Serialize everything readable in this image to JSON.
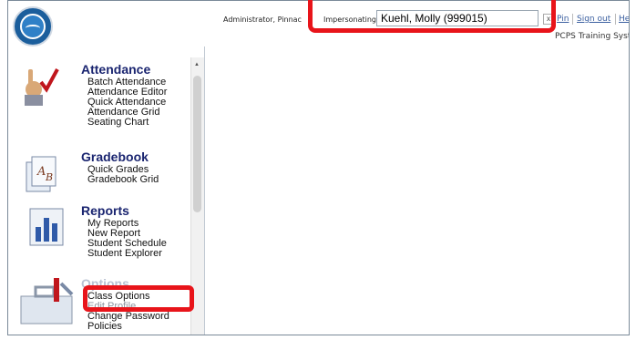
{
  "header": {
    "admin_text": "Administrator, Pinnac",
    "impersonating_label": "Impersonating",
    "impersonating_value": "Kuehl, Molly (999015)",
    "clear_label": "x",
    "links": [
      "Pin",
      "Sign out",
      "Help"
    ],
    "site_title": "PCPS Training System"
  },
  "sidebar": {
    "sections": [
      {
        "title": "Attendance",
        "items": [
          "Batch Attendance",
          "Attendance Editor",
          "Quick Attendance",
          "Attendance Grid",
          "Seating Chart"
        ]
      },
      {
        "title": "Gradebook",
        "items": [
          "Quick Grades",
          "Gradebook Grid"
        ]
      },
      {
        "title": "Reports",
        "items": [
          "My Reports",
          "New Report",
          "Student Schedule",
          "Student Explorer"
        ]
      },
      {
        "title": "Options",
        "items": [
          "Class Options",
          "Edit Profile",
          "Change Password",
          "Policies"
        ]
      }
    ]
  },
  "colors": {
    "highlight": "#e8141a",
    "section_title": "#1a2570",
    "link": "#3a5fa0"
  }
}
